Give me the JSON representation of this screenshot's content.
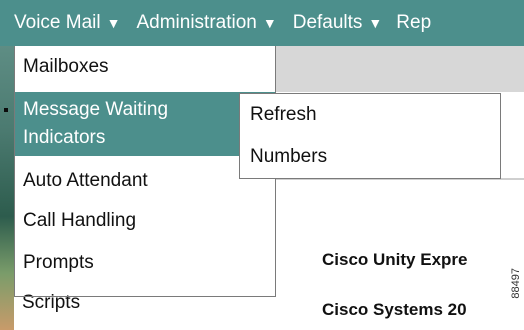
{
  "menubar": {
    "items": [
      {
        "label": "Voice Mail",
        "arrow": "▼"
      },
      {
        "label": "Administration",
        "arrow": "▼"
      },
      {
        "label": "Defaults",
        "arrow": "▼"
      },
      {
        "label": "Rep"
      }
    ]
  },
  "voicemail_menu": {
    "items": [
      "Mailboxes",
      "Message Waiting",
      "Indicators",
      "Auto Attendant",
      "Call Handling",
      "Prompts",
      "Scripts"
    ]
  },
  "submenu": {
    "items": [
      "Refresh",
      "Numbers"
    ]
  },
  "content": {
    "line1": "Cisco Unity Expre",
    "line2": "Cisco Systems 20"
  },
  "doc_id": "88497",
  "colors": {
    "menubar": "#4c8f8c",
    "highlight": "#4c8f8c",
    "menu_text": "#ffffff"
  }
}
